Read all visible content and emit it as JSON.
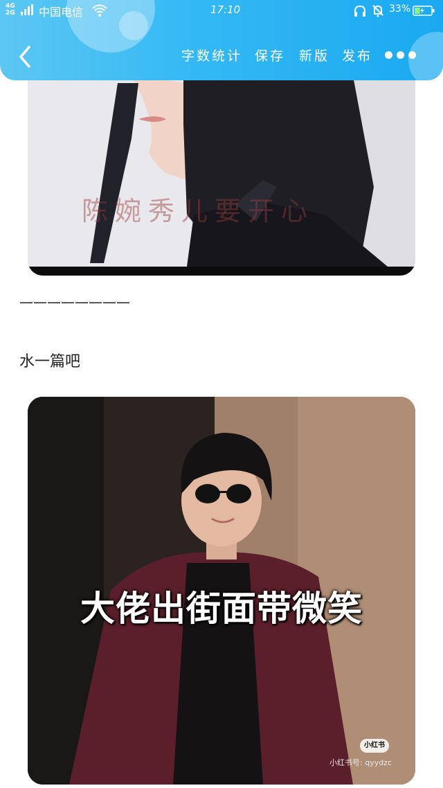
{
  "status_bar": {
    "network": "4G\n2G",
    "carrier": "中国电信",
    "time": "17:10",
    "battery_percent": "33%",
    "battery_level": 0.33
  },
  "navbar": {
    "actions": [
      "字数统计",
      "保存",
      "新版",
      "发布"
    ]
  },
  "content": {
    "divider": "————————",
    "paragraph": "水一篇吧",
    "image1_watermark": "陈婉秀儿要开心",
    "image2_caption": "大佬出街面带微笑",
    "image2_badge": "小红书",
    "image2_id": "小红书号: qyydzc"
  },
  "colors": {
    "header_start": "#5cc7f2",
    "header_end": "#1aa9f0"
  }
}
